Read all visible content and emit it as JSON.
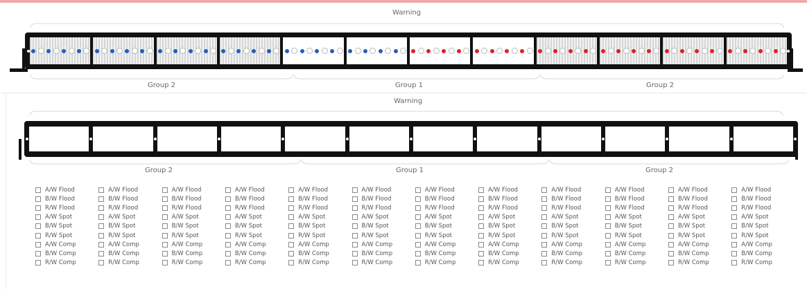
{
  "top": {
    "warning_label": "Warning",
    "group_labels": [
      "Group 2",
      "Group 1",
      "Group 2"
    ],
    "segments": [
      {
        "style": "striped",
        "color": "blue"
      },
      {
        "style": "striped",
        "color": "blue"
      },
      {
        "style": "striped",
        "color": "blue"
      },
      {
        "style": "striped",
        "color": "blue"
      },
      {
        "style": "plain",
        "color": "blue"
      },
      {
        "style": "plain",
        "color": "blue"
      },
      {
        "style": "plain",
        "color": "red"
      },
      {
        "style": "plain",
        "color": "red"
      },
      {
        "style": "striped",
        "color": "red"
      },
      {
        "style": "striped",
        "color": "red"
      },
      {
        "style": "striped",
        "color": "red"
      },
      {
        "style": "striped",
        "color": "red"
      }
    ],
    "colors": {
      "blue": "#1f5fbf",
      "red": "#e02020"
    }
  },
  "bottom": {
    "warning_label": "Warning",
    "group_labels": [
      "Group 2",
      "Group 1",
      "Group 2"
    ],
    "segment_count": 12,
    "options": [
      "A/W Flood",
      "B/W Flood",
      "R/W Flood",
      "A/W Spot",
      "B/W Spot",
      "R/W Spot",
      "A/W Comp",
      "B/W Comp",
      "R/W Comp"
    ]
  }
}
